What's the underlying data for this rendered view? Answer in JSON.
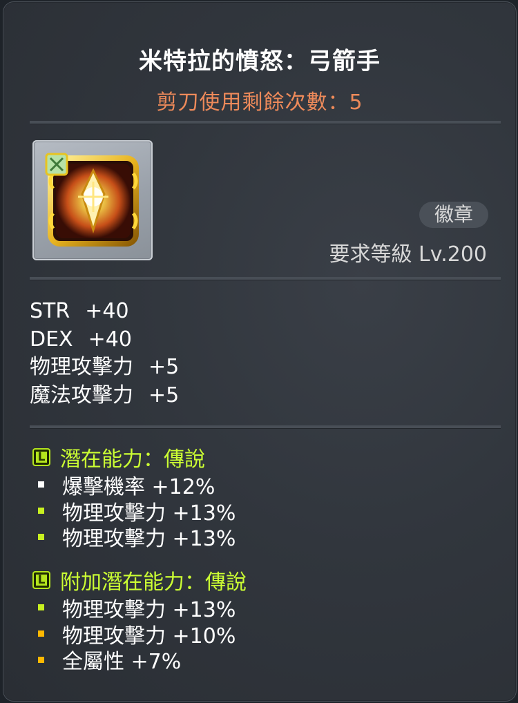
{
  "item": {
    "name": "米特拉的憤怒：弓箭手",
    "scissors": "剪刀使用剩餘次數：5",
    "icon": "mitra-rage-emblem-icon",
    "category": "徽章",
    "required_level": "要求等級 Lv.200"
  },
  "stats": [
    {
      "label": "STR",
      "value": "+40"
    },
    {
      "label": "DEX",
      "value": "+40"
    },
    {
      "label": "物理攻擊力",
      "value": "+5"
    },
    {
      "label": "魔法攻擊力",
      "value": "+5"
    }
  ],
  "potential": {
    "badge": "L",
    "header": "潛在能力：傳說",
    "lines": [
      {
        "text": "爆擊機率 +12%",
        "bullet_color": "#ffffff"
      },
      {
        "text": "物理攻擊力 +13%",
        "bullet_color": "#c8f020"
      },
      {
        "text": "物理攻擊力 +13%",
        "bullet_color": "#c8f020"
      }
    ]
  },
  "bonus_potential": {
    "badge": "L",
    "header": "附加潛在能力：傳說",
    "lines": [
      {
        "text": "物理攻擊力 +13%",
        "bullet_color": "#c8f020"
      },
      {
        "text": "物理攻擊力 +10%",
        "bullet_color": "#ffb800"
      },
      {
        "text": "全屬性 +7%",
        "bullet_color": "#ffb800"
      }
    ]
  },
  "colors": {
    "title": "#ffffff",
    "scissors": "#ee8a5a",
    "potential_header": "#ccff33",
    "legendary_badge": "#b5e61d"
  }
}
